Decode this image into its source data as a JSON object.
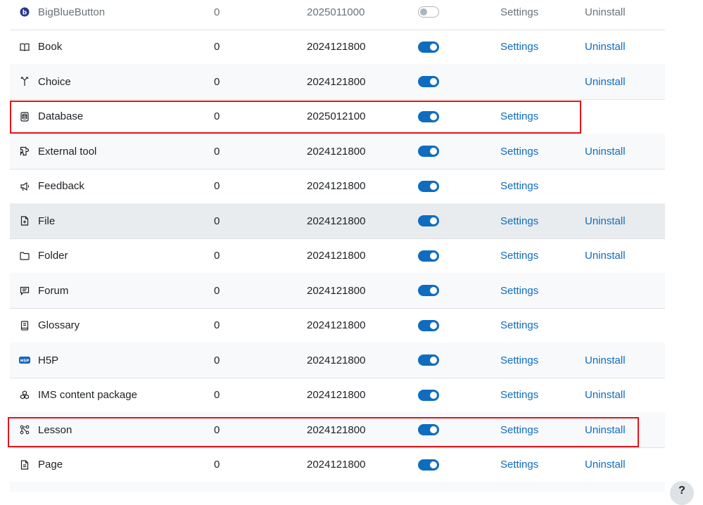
{
  "colors": {
    "link": "#0f6cbf",
    "toggle_on": "#0f6cbf",
    "highlight": "#e3141b",
    "row_alt": "#f8f9fa",
    "row_hover": "#e9ecef"
  },
  "rows": [
    {
      "name": "BigBlueButton",
      "icon": "bigbluebutton-icon",
      "count": "0",
      "version": "2025011000",
      "enabled": false,
      "settings": "Settings",
      "uninstall": "Uninstall"
    },
    {
      "name": "Book",
      "icon": "book-icon",
      "count": "0",
      "version": "2024121800",
      "enabled": true,
      "settings": "Settings",
      "uninstall": "Uninstall"
    },
    {
      "name": "Choice",
      "icon": "choice-icon",
      "count": "0",
      "version": "2024121800",
      "enabled": true,
      "settings": "",
      "uninstall": "Uninstall"
    },
    {
      "name": "Database",
      "icon": "database-icon",
      "count": "0",
      "version": "2025012100",
      "enabled": true,
      "settings": "Settings",
      "uninstall": ""
    },
    {
      "name": "External tool",
      "icon": "external-tool-icon",
      "count": "0",
      "version": "2024121800",
      "enabled": true,
      "settings": "Settings",
      "uninstall": "Uninstall"
    },
    {
      "name": "Feedback",
      "icon": "feedback-icon",
      "count": "0",
      "version": "2024121800",
      "enabled": true,
      "settings": "Settings",
      "uninstall": ""
    },
    {
      "name": "File",
      "icon": "file-icon",
      "count": "0",
      "version": "2024121800",
      "enabled": true,
      "settings": "Settings",
      "uninstall": "Uninstall"
    },
    {
      "name": "Folder",
      "icon": "folder-icon",
      "count": "0",
      "version": "2024121800",
      "enabled": true,
      "settings": "Settings",
      "uninstall": "Uninstall"
    },
    {
      "name": "Forum",
      "icon": "forum-icon",
      "count": "0",
      "version": "2024121800",
      "enabled": true,
      "settings": "Settings",
      "uninstall": ""
    },
    {
      "name": "Glossary",
      "icon": "glossary-icon",
      "count": "0",
      "version": "2024121800",
      "enabled": true,
      "settings": "Settings",
      "uninstall": ""
    },
    {
      "name": "H5P",
      "icon": "h5p-icon",
      "count": "0",
      "version": "2024121800",
      "enabled": true,
      "settings": "Settings",
      "uninstall": "Uninstall"
    },
    {
      "name": "IMS content package",
      "icon": "ims-package-icon",
      "count": "0",
      "version": "2024121800",
      "enabled": true,
      "settings": "Settings",
      "uninstall": "Uninstall"
    },
    {
      "name": "Lesson",
      "icon": "lesson-icon",
      "count": "0",
      "version": "2024121800",
      "enabled": true,
      "settings": "Settings",
      "uninstall": "Uninstall"
    },
    {
      "name": "Page",
      "icon": "page-icon",
      "count": "0",
      "version": "2024121800",
      "enabled": true,
      "settings": "Settings",
      "uninstall": "Uninstall"
    }
  ],
  "help_button": {
    "icon": "help-icon"
  }
}
